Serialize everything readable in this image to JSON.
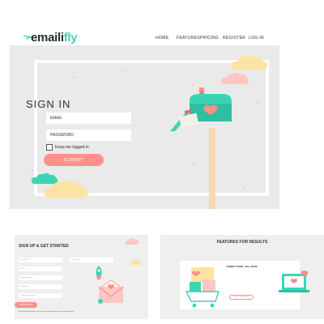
{
  "brand": {
    "logo_dark": "emaili",
    "logo_teal": "fly",
    "teal": "#3dd4b6",
    "coral": "#ff8f8a"
  },
  "nav": {
    "items": [
      {
        "label": "HOME"
      },
      {
        "label": "FEATURES"
      },
      {
        "label": "PRICING"
      },
      {
        "label": "REGISTER"
      },
      {
        "label": "LOG IN"
      }
    ]
  },
  "signin": {
    "title": "SIGN IN",
    "email_placeholder": "EMAIL",
    "password_placeholder": "PASSWORD",
    "remember_label": "Keep me logged in",
    "remember_checked": false,
    "submit_label": "SUBMIT"
  },
  "icons": {
    "mailbox": "mailbox-icon",
    "cloud": "cloud-icon",
    "rocket": "rocket-icon",
    "envelope": "envelope-icon",
    "laptop": "laptop-icon",
    "cart": "shopping-cart-icon",
    "heart": "heart-icon"
  },
  "signup_card": {
    "title": "SIGN UP & GET STARTED",
    "fields": [
      "First name",
      "Last name",
      "Email",
      "Company name",
      "Password",
      "Confirm Password"
    ],
    "button": "SIGN UP NOW",
    "note": "By clicking this button, you agree to our software terms and agreement"
  },
  "features_card": {
    "title": "FEATURES FOR RESULTS",
    "heading": "CONNECT MORE · SELL MORE",
    "button": "EXPLORE MORE"
  }
}
